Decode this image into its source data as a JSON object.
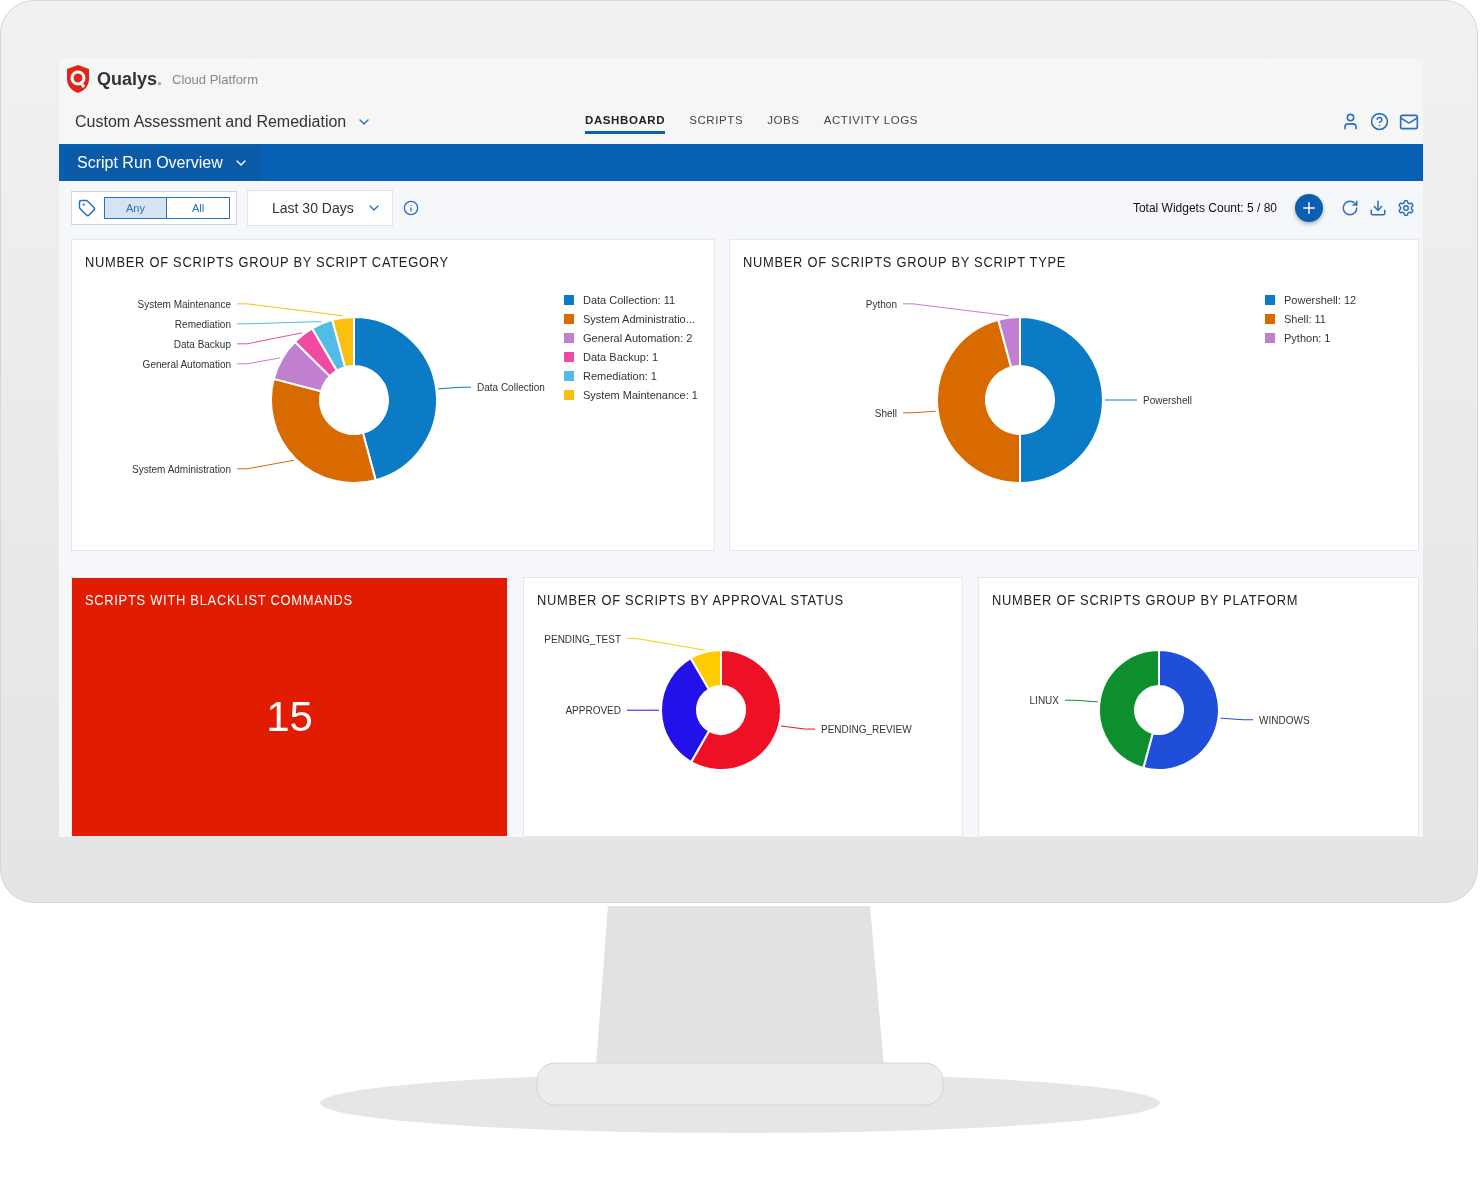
{
  "header": {
    "brand": "Qualys",
    "brand_suffix": ".",
    "platform": "Cloud Platform",
    "app_title": "Custom Assessment and Remediation",
    "nav": [
      {
        "label": "DASHBOARD",
        "selected": true
      },
      {
        "label": "SCRIPTS",
        "selected": false
      },
      {
        "label": "JOBS",
        "selected": false
      },
      {
        "label": "ACTIVITY LOGS",
        "selected": false
      }
    ]
  },
  "dashboard_bar": {
    "title": "Script Run Overview"
  },
  "toolbar": {
    "tag_match": [
      {
        "label": "Any",
        "selected": true
      },
      {
        "label": "All",
        "selected": false
      }
    ],
    "date_range": "Last 30 Days",
    "widgets_count": "Total Widgets Count: 5 / 80"
  },
  "widgets": [
    {
      "kind": "donut",
      "title": "NUMBER OF SCRIPTS GROUP BY SCRIPT CATEGORY",
      "legend": [
        "Data Collection: 11",
        "System Administratio...",
        "General Automation: 2",
        "Data Backup: 1",
        "Remediation: 1",
        "System Maintenance: 1"
      ],
      "chart_data": {
        "type": "donut",
        "categories": [
          "Data Collection",
          "System Administration",
          "General Automation",
          "Data Backup",
          "Remediation",
          "System Maintenance"
        ],
        "colors": [
          "#0a7bc4",
          "#d96a00",
          "#c17fd0",
          "#f14aa3",
          "#51bde6",
          "#fbbf10"
        ],
        "values": [
          45.8,
          33.3,
          8.3,
          4.2,
          4.2,
          4.2
        ]
      }
    },
    {
      "kind": "donut",
      "title": "NUMBER OF SCRIPTS GROUP BY SCRIPT TYPE",
      "legend": [
        "Powershell: 12",
        "Shell: 11",
        "Python: 1"
      ],
      "chart_data": {
        "type": "donut",
        "categories": [
          "Powershell",
          "Shell",
          "Python"
        ],
        "colors": [
          "#0a7bc4",
          "#d96a00",
          "#c17fd0"
        ],
        "values": [
          50,
          45.8,
          4.2
        ]
      }
    },
    {
      "kind": "number",
      "title": "SCRIPTS WITH BLACKLIST COMMANDS",
      "value": "15"
    },
    {
      "kind": "donut",
      "title": "NUMBER OF SCRIPTS BY APPROVAL STATUS",
      "chart_data": {
        "type": "donut",
        "categories": [
          "PENDING_REVIEW",
          "APPROVED",
          "PENDING_TEST"
        ],
        "colors": [
          "#ee1125",
          "#2211e8",
          "#ffcc00"
        ],
        "values": [
          58.3,
          33.3,
          8.4
        ]
      }
    },
    {
      "kind": "donut",
      "title": "NUMBER OF SCRIPTS GROUP BY PLATFORM",
      "chart_data": {
        "type": "donut",
        "categories": [
          "WINDOWS",
          "LINUX"
        ],
        "colors": [
          "#1f4fd8",
          "#0c8f2c"
        ],
        "values": [
          54.2,
          45.8
        ]
      }
    }
  ]
}
